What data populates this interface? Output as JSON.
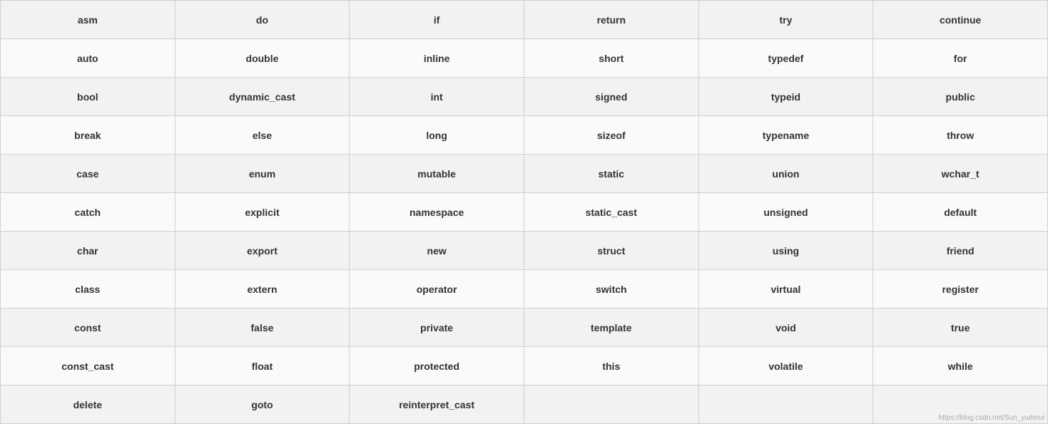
{
  "table": {
    "rows": [
      [
        "asm",
        "do",
        "if",
        "return",
        "try",
        "continue"
      ],
      [
        "auto",
        "double",
        "inline",
        "short",
        "typedef",
        "for"
      ],
      [
        "bool",
        "dynamic_cast",
        "int",
        "signed",
        "typeid",
        "public"
      ],
      [
        "break",
        "else",
        "long",
        "sizeof",
        "typename",
        "throw"
      ],
      [
        "case",
        "enum",
        "mutable",
        "static",
        "union",
        "wchar_t"
      ],
      [
        "catch",
        "explicit",
        "namespace",
        "static_cast",
        "unsigned",
        "default"
      ],
      [
        "char",
        "export",
        "new",
        "struct",
        "using",
        "friend"
      ],
      [
        "class",
        "extern",
        "operator",
        "switch",
        "virtual",
        "register"
      ],
      [
        "const",
        "false",
        "private",
        "template",
        "void",
        "true"
      ],
      [
        "const_cast",
        "float",
        "protected",
        "this",
        "volatile",
        "while"
      ],
      [
        "delete",
        "goto",
        "reinterpret_cast",
        "",
        "",
        ""
      ]
    ],
    "watermark": "https://blog.csdn.net/Sun_yuderui"
  }
}
